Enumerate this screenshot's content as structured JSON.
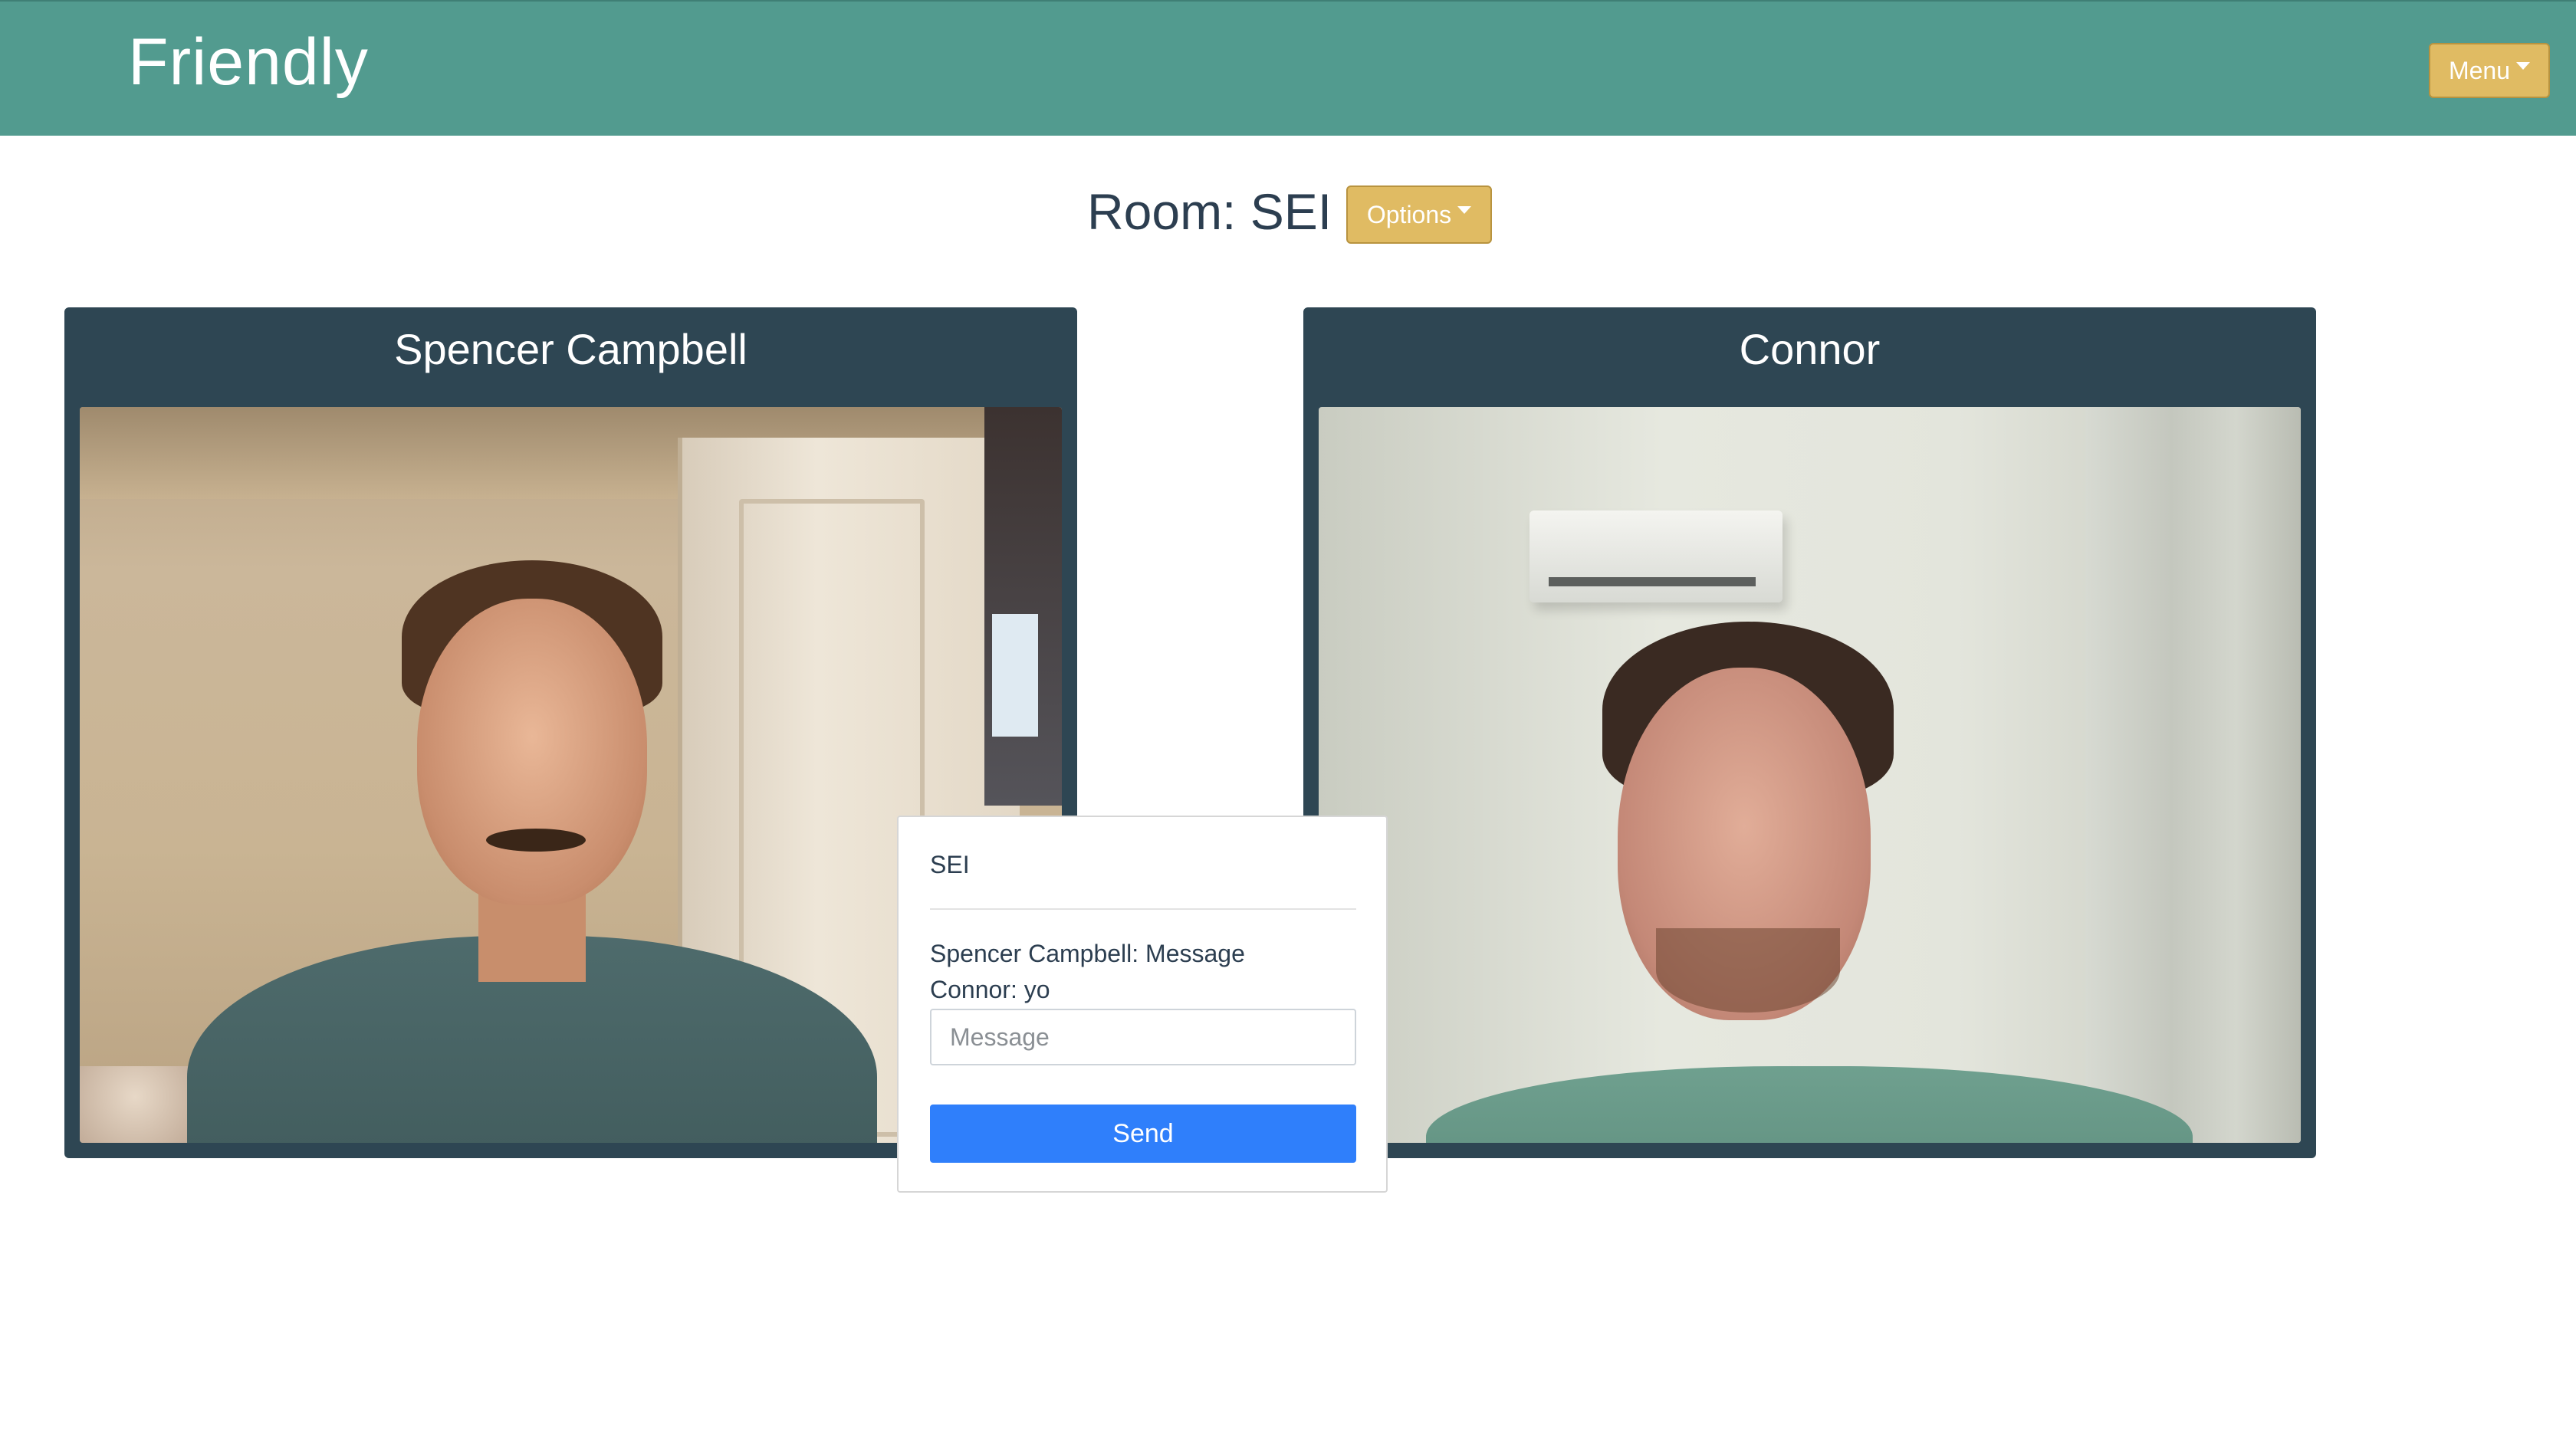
{
  "navbar": {
    "brand": "Friendly",
    "menu_label": "Menu",
    "background_color": "#529b8f",
    "button_color": "#e0bb63"
  },
  "room": {
    "title": "Room: SEI",
    "options_label": "Options"
  },
  "participants": [
    {
      "name": "Spencer Campbell"
    },
    {
      "name": "Connor"
    }
  ],
  "chat": {
    "room_name": "SEI",
    "messages": [
      {
        "text": "Spencer Campbell: Message"
      },
      {
        "text": "Connor: yo"
      }
    ],
    "input_placeholder": "Message",
    "input_value": "",
    "send_label": "Send",
    "send_color": "#2f7ffb"
  },
  "icons": {
    "menu_caret": "caret-down-icon",
    "options_caret": "caret-down-icon"
  }
}
